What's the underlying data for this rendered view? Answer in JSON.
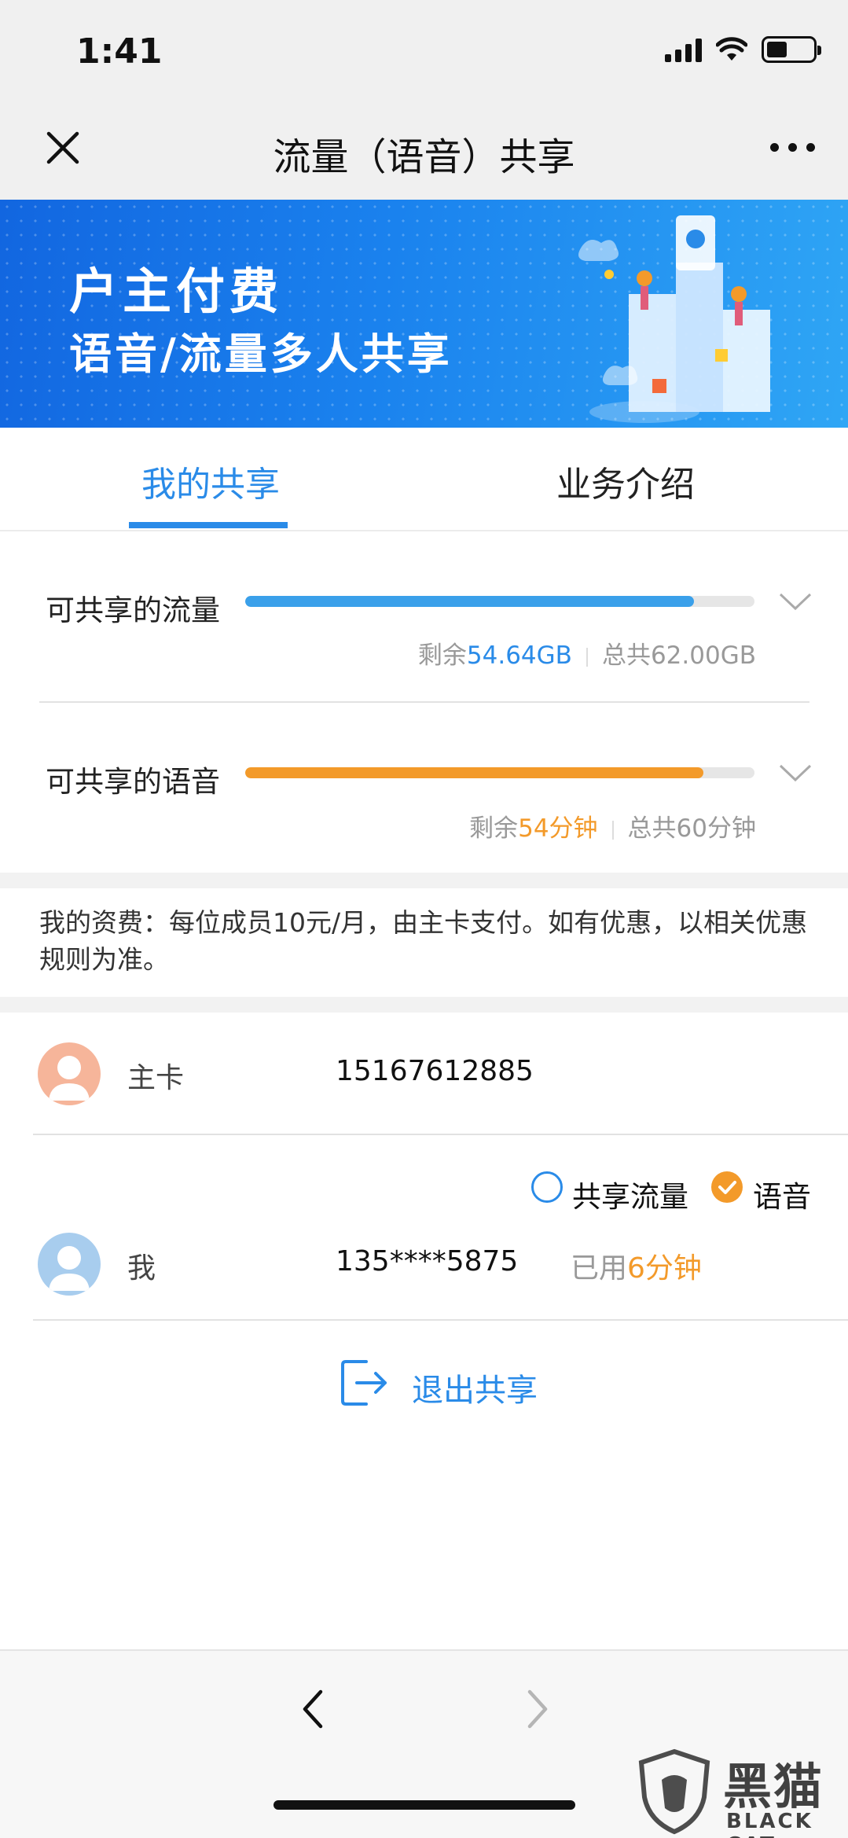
{
  "status": {
    "time": "1:41"
  },
  "nav": {
    "title": "流量（语音）共享"
  },
  "banner": {
    "line1": "户主付费",
    "line2": "语音/流量多人共享"
  },
  "tabs": [
    {
      "label": "我的共享",
      "active": true
    },
    {
      "label": "业务介绍",
      "active": false
    }
  ],
  "data_share": {
    "label": "可共享的流量",
    "remain_prefix": "剩余",
    "remain": "54.64GB",
    "total_label": "总共62.00GB",
    "fraction": 0.881,
    "color": "#3aa0ea"
  },
  "voice_share": {
    "label": "可共享的语音",
    "remain_prefix": "剩余",
    "remain": "54分钟",
    "total_label": "总共60分钟",
    "fraction": 0.9,
    "color": "#f39a2a"
  },
  "fee": {
    "text": "我的资费：每位成员10元/月，由主卡支付。如有优惠，以相关优惠规则为准。"
  },
  "members": {
    "primary": {
      "role": "主卡",
      "number": "15167612885"
    },
    "me": {
      "role": "我",
      "number": "135****5875",
      "used_prefix": "已用",
      "used_value": "6分钟",
      "option_data": "共享流量",
      "option_voice": "语音",
      "option_data_checked": false,
      "option_voice_checked": true
    }
  },
  "exit_label": "退出共享",
  "watermark": {
    "cn": "黑猫",
    "en": "BLACK CAT"
  },
  "colors": {
    "accent": "#2a8be8",
    "orange": "#f39a2a"
  }
}
